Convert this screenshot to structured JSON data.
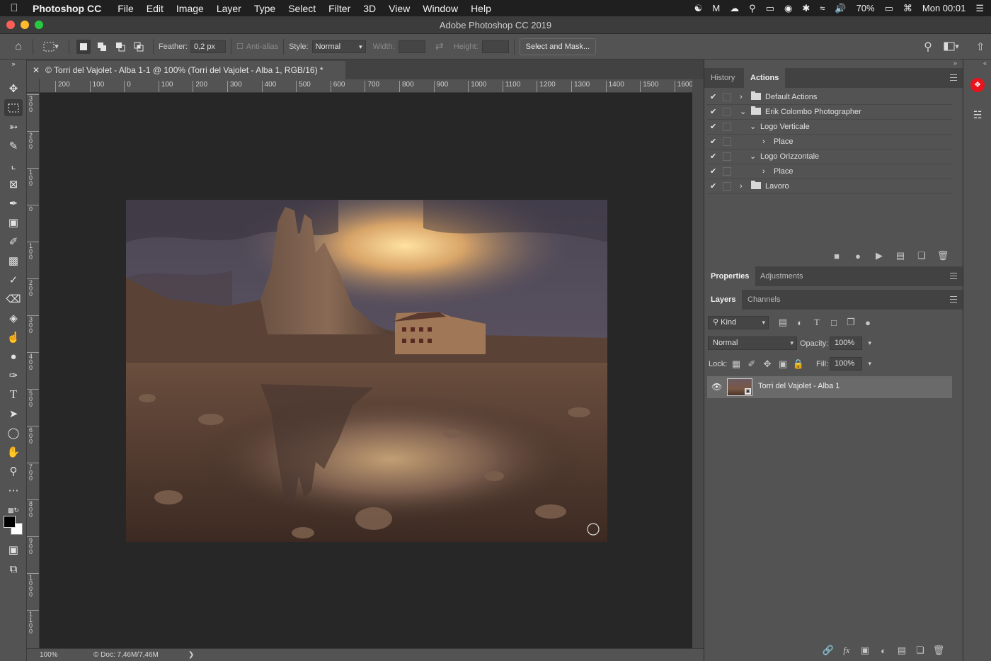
{
  "menubar": {
    "app_name": "Photoshop CC",
    "menus": [
      "File",
      "Edit",
      "Image",
      "Layer",
      "Type",
      "Select",
      "Filter",
      "3D",
      "View",
      "Window",
      "Help"
    ],
    "battery": "70%",
    "clock": "Mon 00:01"
  },
  "window": {
    "title": "Adobe Photoshop CC 2019"
  },
  "options": {
    "feather_label": "Feather:",
    "feather_value": "0,2 px",
    "antialias_label": "Anti-alias",
    "style_label": "Style:",
    "style_value": "Normal",
    "width_label": "Width:",
    "height_label": "Height:",
    "select_mask_label": "Select and Mask..."
  },
  "document": {
    "tab_title": "© Torri del Vajolet - Alba 1-1 @ 100% (Torri del Vajolet - Alba 1, RGB/16) *",
    "zoom": "100%",
    "doc_info": "Doc: 7,46M/7,46M"
  },
  "rulers": {
    "horizontal": [
      "200",
      "100",
      "0",
      "100",
      "200",
      "300",
      "400",
      "500",
      "600",
      "700",
      "800",
      "900",
      "1000",
      "1100",
      "1200",
      "1300",
      "1400",
      "1500",
      "1600"
    ],
    "vertical": [
      "300",
      "200",
      "100",
      "0",
      "100",
      "200",
      "300",
      "400",
      "500",
      "600",
      "700",
      "800",
      "900",
      "1000",
      "1100"
    ]
  },
  "history_panel": {
    "tabs": [
      "History",
      "Actions"
    ],
    "active_tab": "Actions",
    "actions": [
      {
        "label": "Default Actions",
        "type": "set",
        "expanded": false,
        "level": 0
      },
      {
        "label": "Erik Colombo Photographer",
        "type": "set",
        "expanded": true,
        "level": 0
      },
      {
        "label": "Logo Verticale",
        "type": "action",
        "expanded": true,
        "level": 1
      },
      {
        "label": "Place",
        "type": "step",
        "expanded": false,
        "level": 2
      },
      {
        "label": "Logo Orizzontale",
        "type": "action",
        "expanded": true,
        "level": 1
      },
      {
        "label": "Place",
        "type": "step",
        "expanded": false,
        "level": 2
      },
      {
        "label": "Lavoro",
        "type": "set",
        "expanded": false,
        "level": 0
      }
    ]
  },
  "properties_panel": {
    "tabs": [
      "Properties",
      "Adjustments"
    ],
    "active_tab": "Properties"
  },
  "layers_panel": {
    "tabs": [
      "Layers",
      "Channels"
    ],
    "active_tab": "Layers",
    "filter_kind": "Kind",
    "blend_mode": "Normal",
    "opacity_label": "Opacity:",
    "opacity": "100%",
    "lock_label": "Lock:",
    "fill_label": "Fill:",
    "fill": "100%",
    "layers": [
      {
        "name": "Torri del Vajolet - Alba 1",
        "visible": true
      }
    ]
  },
  "colors": {
    "ui_bg": "#535353",
    "canvas_bg": "#272727",
    "menubar_bg": "#1f1f1f",
    "cc_badge": "#e8131d"
  }
}
